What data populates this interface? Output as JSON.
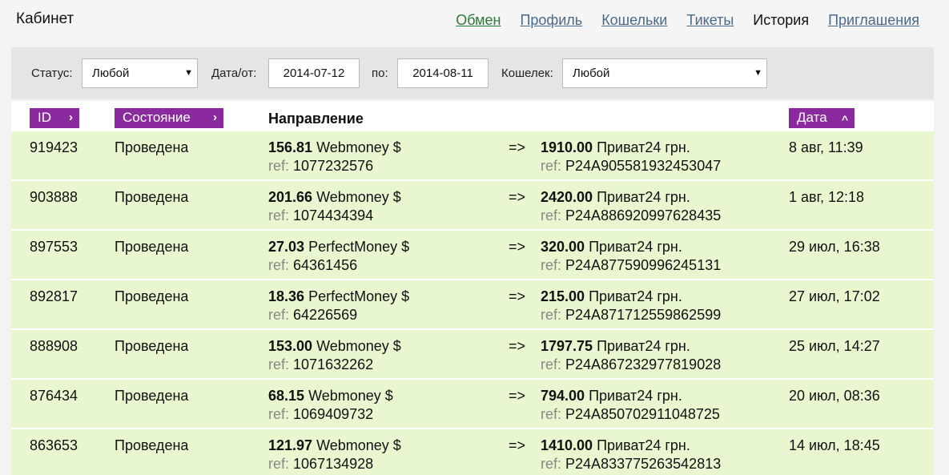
{
  "header": {
    "title": "Кабинет",
    "nav": [
      {
        "label": "Обмен",
        "style": "green"
      },
      {
        "label": "Профиль",
        "style": "link"
      },
      {
        "label": "Кошельки",
        "style": "link"
      },
      {
        "label": "Тикеты",
        "style": "link"
      },
      {
        "label": "История",
        "style": "current"
      },
      {
        "label": "Приглашения",
        "style": "link"
      }
    ]
  },
  "filters": {
    "status_label": "Статус:",
    "status_value": "Любой",
    "date_from_label": "Дата/от:",
    "date_from_value": "2014-07-12",
    "date_to_label": "по:",
    "date_to_value": "2014-08-11",
    "wallet_label": "Кошелек:",
    "wallet_value": "Любой",
    "dropdown_arrow": "▼"
  },
  "table": {
    "col_id": "ID",
    "col_state": "Состояние",
    "col_direction": "Направление",
    "col_date": "Дата",
    "chev_right": "›",
    "chev_up": "^",
    "arrow": "=>",
    "ref_prefix": "ref:",
    "rows": [
      {
        "id": "919423",
        "state": "Проведена",
        "from_amount": "156.81",
        "from_wallet": "Webmoney $",
        "from_ref": "1077232576",
        "to_amount": "1910.00",
        "to_wallet": "Приват24 грн.",
        "to_ref": "P24A905581932453047",
        "date": "8 авг, 11:39"
      },
      {
        "id": "903888",
        "state": "Проведена",
        "from_amount": "201.66",
        "from_wallet": "Webmoney $",
        "from_ref": "1074434394",
        "to_amount": "2420.00",
        "to_wallet": "Приват24 грн.",
        "to_ref": "P24A886920997628435",
        "date": "1 авг, 12:18"
      },
      {
        "id": "897553",
        "state": "Проведена",
        "from_amount": "27.03",
        "from_wallet": "PerfectMoney $",
        "from_ref": "64361456",
        "to_amount": "320.00",
        "to_wallet": "Приват24 грн.",
        "to_ref": "P24A877590996245131",
        "date": "29 июл, 16:38"
      },
      {
        "id": "892817",
        "state": "Проведена",
        "from_amount": "18.36",
        "from_wallet": "PerfectMoney $",
        "from_ref": "64226569",
        "to_amount": "215.00",
        "to_wallet": "Приват24 грн.",
        "to_ref": "P24A871712559862599",
        "date": "27 июл, 17:02"
      },
      {
        "id": "888908",
        "state": "Проведена",
        "from_amount": "153.00",
        "from_wallet": "Webmoney $",
        "from_ref": "1071632262",
        "to_amount": "1797.75",
        "to_wallet": "Приват24 грн.",
        "to_ref": "P24A867232977819028",
        "date": "25 июл, 14:27"
      },
      {
        "id": "876434",
        "state": "Проведена",
        "from_amount": "68.15",
        "from_wallet": "Webmoney $",
        "from_ref": "1069409732",
        "to_amount": "794.00",
        "to_wallet": "Приват24 грн.",
        "to_ref": "P24A850702911048725",
        "date": "20 июл, 08:36"
      },
      {
        "id": "863653",
        "state": "Проведена",
        "from_amount": "121.97",
        "from_wallet": "Webmoney $",
        "from_ref": "1067134928",
        "to_amount": "1410.00",
        "to_wallet": "Приват24 грн.",
        "to_ref": "P24A833775263542813",
        "date": "14 июл, 18:45"
      }
    ]
  },
  "colors": {
    "accent_purple": "#8a2a9e",
    "row_green": "#e8f7d0",
    "link_green": "#2a7a3a",
    "link_blue": "#4a6a8a"
  }
}
